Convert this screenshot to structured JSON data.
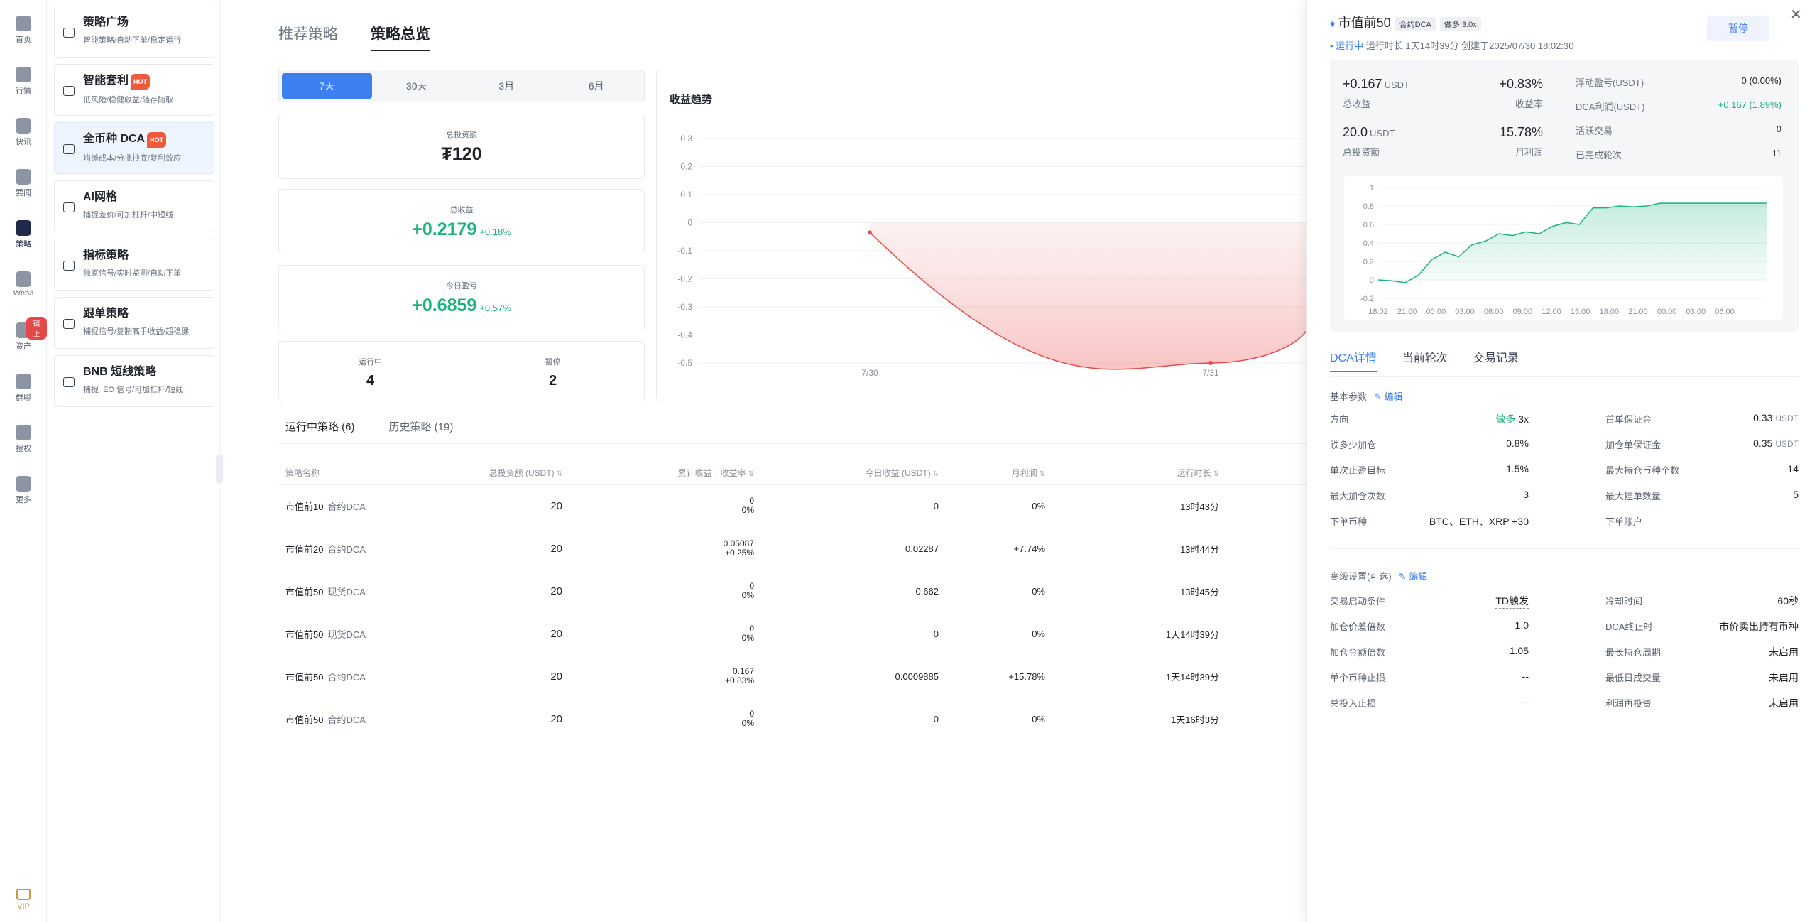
{
  "rail": {
    "items": [
      {
        "label": "首页",
        "icon": "home-icon"
      },
      {
        "label": "行情",
        "icon": "bar-chart-icon"
      },
      {
        "label": "快讯",
        "icon": "news-icon"
      },
      {
        "label": "要闻",
        "icon": "document-icon"
      },
      {
        "label": "策略",
        "icon": "robot-icon"
      },
      {
        "label": "Web3",
        "icon": "web3-icon"
      },
      {
        "label": "资产",
        "icon": "wallet-icon"
      },
      {
        "label": "群聊",
        "icon": "chat-icon"
      },
      {
        "label": "授权",
        "icon": "key-icon"
      },
      {
        "label": "更多",
        "icon": "grid-icon"
      }
    ],
    "asset_badge": "链上",
    "vip": "VIP"
  },
  "menu": {
    "items": [
      {
        "title": "策略广场",
        "desc": "智能策略/自动下单/稳定运行",
        "hot": ""
      },
      {
        "title": "智能套利",
        "desc": "低风险/稳健收益/随存随取",
        "hot": "HOT"
      },
      {
        "title": "全币种 DCA",
        "desc": "均摊成本/分批抄底/复利效应",
        "hot": "HOT"
      },
      {
        "title": "AI网格",
        "desc": "捕捉差价/可加杠杆/中短线",
        "hot": ""
      },
      {
        "title": "指标策略",
        "desc": "独家信号/实时监测/自动下单",
        "hot": ""
      },
      {
        "title": "跟单策略",
        "desc": "捕捉信号/复制高手收益/超稳健",
        "hot": ""
      },
      {
        "title": "BNB 短线策略",
        "desc": "捕捉 IEO 信号/可加杠杆/短线",
        "hot": ""
      }
    ]
  },
  "main": {
    "tabs": [
      "推荐策略",
      "策略总览"
    ],
    "periods": [
      "7天",
      "30天",
      "3月",
      "6月"
    ],
    "total_invest": {
      "label": "总投资额",
      "value": "₮120"
    },
    "total_profit": {
      "label": "总收益",
      "value": "+0.2179",
      "pct": "+0.18%"
    },
    "today_profit": {
      "label": "今日盈亏",
      "value": "+0.6859",
      "pct": "+0.57%"
    },
    "running": {
      "label": "运行中",
      "value": "4"
    },
    "paused": {
      "label": "暂停",
      "value": "2"
    },
    "chart_title": "收益趋势",
    "subtabs": [
      "运行中策略 (6)",
      "历史策略 (19)"
    ],
    "table": {
      "headers": [
        "策略名称",
        "总投资额 (USDT)",
        "累计收益丨收益率",
        "今日收益 (USDT)",
        "月利润",
        "运行时长"
      ],
      "rows": [
        {
          "name": "市值前10",
          "type": "合约DCA",
          "invest": "20",
          "cum": "0",
          "rate": "0%",
          "today": "0",
          "month": "0%",
          "dur": "13时43分"
        },
        {
          "name": "市值前20",
          "type": "合约DCA",
          "invest": "20",
          "cum": "0.05087",
          "rate": "+0.25%",
          "today": "0.02287",
          "month": "+7.74%",
          "dur": "13时44分"
        },
        {
          "name": "市值前50",
          "type": "现货DCA",
          "invest": "20",
          "cum": "0",
          "rate": "0%",
          "today": "0.662",
          "month": "0%",
          "dur": "13时45分"
        },
        {
          "name": "市值前50",
          "type": "现货DCA",
          "invest": "20",
          "cum": "0",
          "rate": "0%",
          "today": "0",
          "month": "0%",
          "dur": "1天14时39分"
        },
        {
          "name": "市值前50",
          "type": "合约DCA",
          "invest": "20",
          "cum": "0.167",
          "rate": "+0.83%",
          "today": "0.0009885",
          "month": "+15.78%",
          "dur": "1天14时39分"
        },
        {
          "name": "市值前50",
          "type": "合约DCA",
          "invest": "20",
          "cum": "0",
          "rate": "0%",
          "today": "0",
          "month": "0%",
          "dur": "1天16时3分"
        }
      ]
    }
  },
  "chart_data": [
    {
      "type": "area",
      "title": "收益趋势",
      "x": [
        "7/30",
        "7/31"
      ],
      "y_ticks": [
        "0.3",
        "0.2",
        "0.1",
        "0",
        "-0.1",
        "-0.2",
        "-0.3",
        "-0.4",
        "-0.5"
      ],
      "ylim": [
        -0.5,
        0.3
      ],
      "series": [
        {
          "points": [
            [
              "7/30",
              -0.035
            ],
            [
              "7/31",
              -0.5
            ]
          ]
        }
      ],
      "color": "#e84a4a"
    },
    {
      "type": "area",
      "x_ticks": [
        "18:02",
        "21:00",
        "00:00",
        "03:00",
        "06:00",
        "09:00",
        "12:00",
        "15:00",
        "18:00",
        "21:00",
        "00:00",
        "03:00",
        "06:00"
      ],
      "y_ticks": [
        "1",
        "0.8",
        "0.6",
        "0.4",
        "0.2",
        "0",
        "-0.2"
      ],
      "ylim": [
        -0.2,
        1
      ],
      "values": [
        0,
        -0.01,
        -0.03,
        0.05,
        0.22,
        0.3,
        0.25,
        0.38,
        0.42,
        0.5,
        0.48,
        0.52,
        0.5,
        0.58,
        0.62,
        0.6,
        0.78,
        0.78,
        0.8,
        0.79,
        0.8,
        0.83,
        0.83,
        0.83,
        0.83,
        0.83,
        0.83,
        0.83,
        0.83,
        0.83
      ],
      "color": "#19b37b"
    }
  ],
  "panel": {
    "title": "市值前50",
    "chip_type": "合约DCA",
    "chip_dir": "做多 3.0x",
    "status_run": "• 运行中",
    "status_rest": "运行时长 1天14时39分 创建于2025/07/30 18:02:30",
    "pause": "暂停",
    "close": "✕",
    "stats": {
      "profit_val": "+0.167",
      "profit_unit": "USDT",
      "profit_label": "总收益",
      "rate_val": "+0.83%",
      "rate_label": "收益率",
      "invest_val": "20.0",
      "invest_unit": "USDT",
      "invest_label": "总投资额",
      "month_val": "15.78%",
      "month_label": "月利润",
      "right": [
        {
          "k": "浮动盈亏(USDT)",
          "v": "0 (0.00%)"
        },
        {
          "k": "DCA利润(USDT)",
          "v": "+0.167 (1.89%)"
        },
        {
          "k": "活跃交易",
          "v": "0"
        },
        {
          "k": "已完成轮次",
          "v": "11"
        }
      ]
    },
    "tabs": [
      "DCA详情",
      "当前轮次",
      "交易记录"
    ],
    "basic_title": "基本参数",
    "edit": "编辑",
    "basic": [
      {
        "k": "方向",
        "v": "做多",
        "v2": "3x"
      },
      {
        "k": "首单保证金",
        "v": "0.33",
        "u": "USDT"
      },
      {
        "k": "跌多少加仓",
        "v": "0.8%"
      },
      {
        "k": "加仓单保证金",
        "v": "0.35",
        "u": "USDT"
      },
      {
        "k": "单次止盈目标",
        "v": "1.5%"
      },
      {
        "k": "最大持仓币种个数",
        "v": "14"
      },
      {
        "k": "最大加仓次数",
        "v": "3"
      },
      {
        "k": "最大挂单数量",
        "v": "5"
      },
      {
        "k": "下单币种",
        "v": "BTC、ETH、XRP +30"
      },
      {
        "k": "下单账户",
        "v": ""
      }
    ],
    "adv_title": "高级设置(可选)",
    "adv": [
      {
        "k": "交易启动条件",
        "v": "TD触发"
      },
      {
        "k": "冷却时间",
        "v": "60秒"
      },
      {
        "k": "加仓价差倍数",
        "v": "1.0"
      },
      {
        "k": "DCA终止时",
        "v": "市价卖出持有币种"
      },
      {
        "k": "加仓金额倍数",
        "v": "1.05"
      },
      {
        "k": "最长持仓周期",
        "v": "未启用"
      },
      {
        "k": "单个币种止损",
        "v": "--"
      },
      {
        "k": "最低日成交量",
        "v": "未启用"
      },
      {
        "k": "总投入止损",
        "v": "--"
      },
      {
        "k": "利润再投资",
        "v": "未启用"
      }
    ]
  }
}
